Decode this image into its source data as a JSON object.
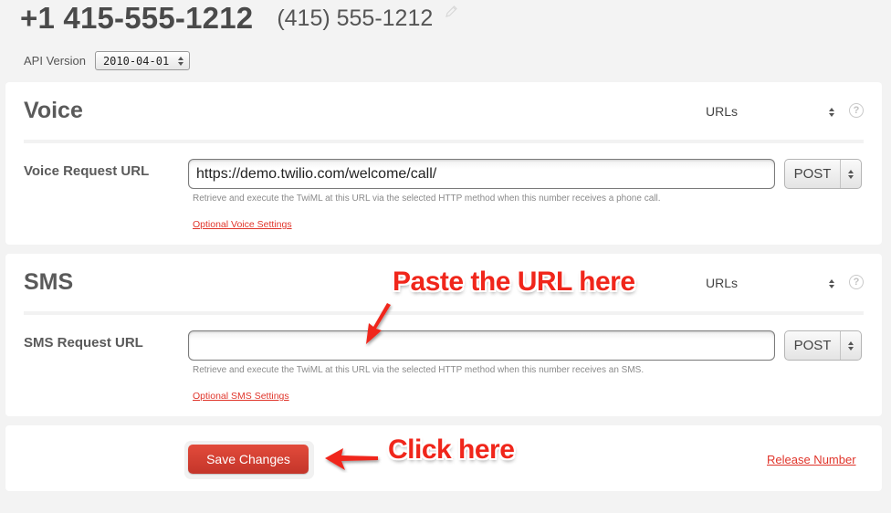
{
  "header": {
    "phone_number": "+1 415-555-1212",
    "phone_friendly": "(415) 555-1212",
    "edit_icon": "pencil-icon"
  },
  "api_version": {
    "label": "API Version",
    "selected": "2010-04-01"
  },
  "voice": {
    "title": "Voice",
    "mode_selected": "URLs",
    "help_icon": "question-icon",
    "help_glyph": "?",
    "field_label": "Voice Request URL",
    "url_value": "https://demo.twilio.com/welcome/call/",
    "method": "POST",
    "help_text": "Retrieve and execute the TwiML at this URL via the selected HTTP method when this number receives a phone call.",
    "optional_link": "Optional Voice Settings"
  },
  "sms": {
    "title": "SMS",
    "mode_selected": "URLs",
    "help_icon": "question-icon",
    "help_glyph": "?",
    "field_label": "SMS Request URL",
    "url_value": "",
    "method": "POST",
    "help_text": "Retrieve and execute the TwiML at this URL via the selected HTTP method when this number receives an SMS.",
    "optional_link": "Optional SMS Settings"
  },
  "footer": {
    "save_label": "Save Changes",
    "release_label": "Release Number"
  },
  "annotations": {
    "paste_callout": "Paste the URL here",
    "click_callout": "Click here",
    "color": "#f0261b"
  },
  "colors": {
    "background": "#f3f3f3",
    "panel": "#ffffff",
    "accent_red": "#e0352b",
    "button_red": "#d23f31"
  }
}
